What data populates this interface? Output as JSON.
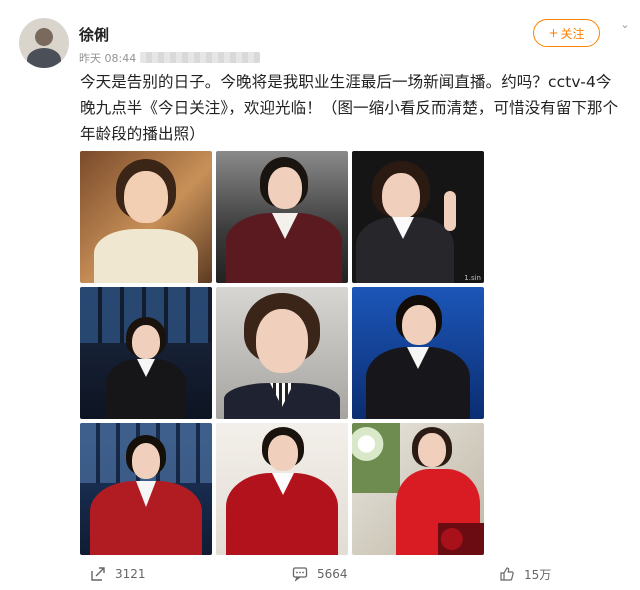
{
  "post": {
    "author": "徐俐",
    "time": "昨天 08:44",
    "follow_label": "关注",
    "follow_icon": "plus",
    "text": "今天是告别的日子。今晚将是我职业生涯最后一场新闻直播。约吗？cctv-4今晚九点半《今日关注》，欢迎光临！（图一缩小看反而清楚，可惜没有留下那个年龄段的播出照）"
  },
  "actions": {
    "repost_count": "3121",
    "comment_count": "5664",
    "like_count": "15万"
  },
  "photos": [
    {
      "name": "photo-1",
      "watermark": ""
    },
    {
      "name": "photo-2",
      "watermark": ""
    },
    {
      "name": "photo-3",
      "watermark": "1.sin"
    },
    {
      "name": "photo-4",
      "watermark": ""
    },
    {
      "name": "photo-5",
      "watermark": ""
    },
    {
      "name": "photo-6",
      "watermark": ""
    },
    {
      "name": "photo-7",
      "watermark": ""
    },
    {
      "name": "photo-8",
      "watermark": ""
    },
    {
      "name": "photo-9",
      "watermark": ""
    }
  ]
}
